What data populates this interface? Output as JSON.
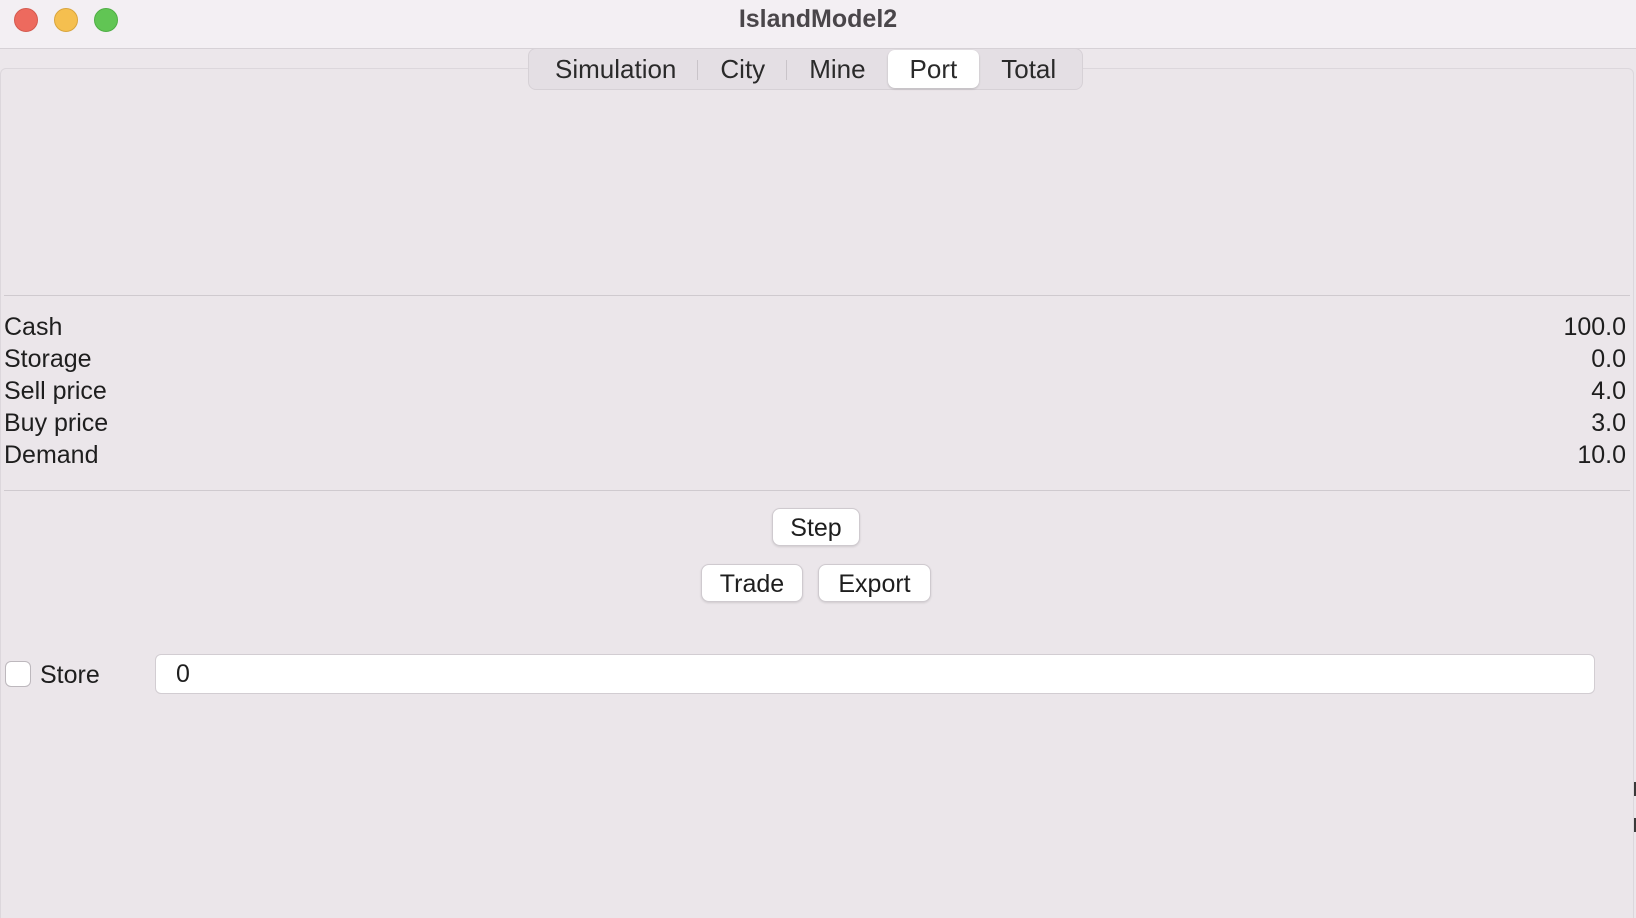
{
  "window": {
    "title": "IslandModel2"
  },
  "tabs": [
    {
      "label": "Simulation",
      "active": false
    },
    {
      "label": "City",
      "active": false
    },
    {
      "label": "Mine",
      "active": false
    },
    {
      "label": "Port",
      "active": true
    },
    {
      "label": "Total",
      "active": false
    }
  ],
  "stats": [
    {
      "label": "Cash",
      "value": "100.0"
    },
    {
      "label": "Storage",
      "value": "0.0"
    },
    {
      "label": "Sell price",
      "value": "4.0"
    },
    {
      "label": "Buy price",
      "value": "3.0"
    },
    {
      "label": "Demand",
      "value": "10.0"
    }
  ],
  "buttons": {
    "step": "Step",
    "trade": "Trade",
    "export": "Export"
  },
  "store": {
    "label": "Store",
    "checked": false,
    "value": "0"
  },
  "colors": {
    "close": "#ed6a5e",
    "minimize": "#f5bf4f",
    "maximize": "#61c554",
    "window_bg": "#ece7eb"
  }
}
